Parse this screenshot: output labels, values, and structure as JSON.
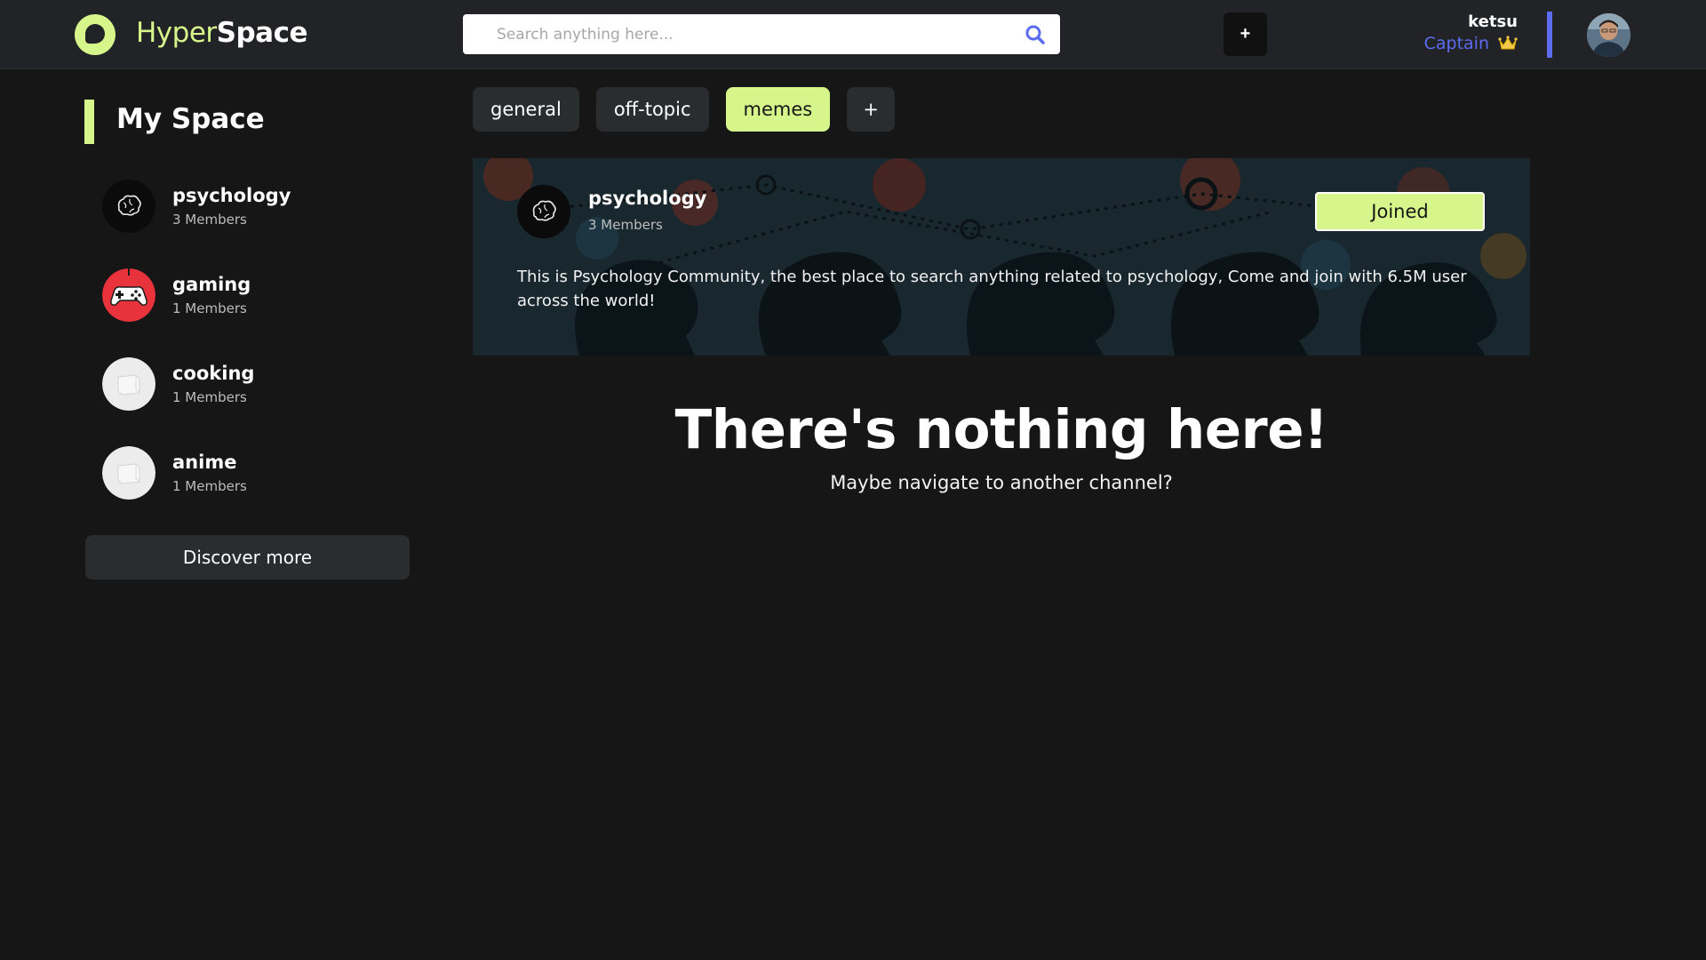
{
  "app": {
    "logo_part1": "Hyper",
    "logo_part2": "Space",
    "accent_color": "#d6f58a",
    "secondary_color": "#5b6cf0"
  },
  "header": {
    "search_placeholder": "Search anything here...",
    "add_label": "+",
    "user_name": "ketsu",
    "user_role": "Captain",
    "role_icon": "crown-icon",
    "avatar_icon": "user-avatar"
  },
  "sidebar": {
    "title": "My Space",
    "communities": [
      {
        "name": "psychology",
        "members": "3 Members",
        "icon": "brain-icon"
      },
      {
        "name": "gaming",
        "members": "1 Members",
        "icon": "gamepad-icon"
      },
      {
        "name": "cooking",
        "members": "1 Members",
        "icon": "placeholder-icon"
      },
      {
        "name": "anime",
        "members": "1 Members",
        "icon": "placeholder-icon"
      }
    ],
    "discover_label": "Discover more"
  },
  "channels": {
    "tabs": [
      "general",
      "off-topic",
      "memes"
    ],
    "active": "memes",
    "add_label": "+"
  },
  "banner": {
    "name": "psychology",
    "members": "3 Members",
    "joined_label": "Joined",
    "description": "This is Psychology Community, the best place to search anything related to psychology, Come and join with 6.5M user across the world!"
  },
  "empty": {
    "title": "There's nothing here!",
    "subtitle": "Maybe navigate to another channel?"
  }
}
